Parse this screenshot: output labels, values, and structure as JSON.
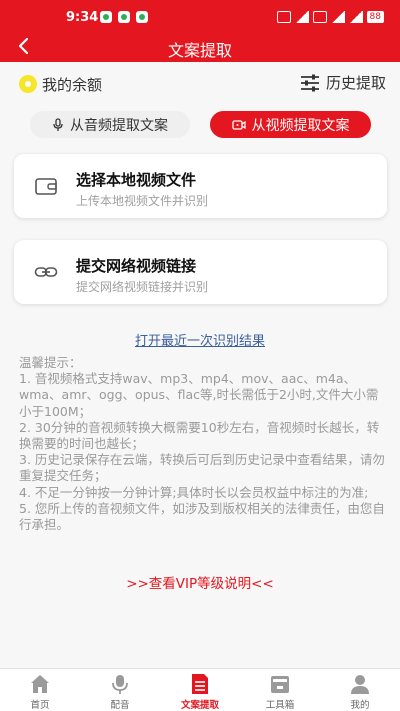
{
  "status_bar": {
    "time": "9:34",
    "battery": "88"
  },
  "header": {
    "title": "文案提取"
  },
  "balance": {
    "label": "我的余额"
  },
  "history": {
    "label": "历史提取"
  },
  "tabs": [
    {
      "label": "从音频提取文案",
      "active": false
    },
    {
      "label": "从视频提取文案",
      "active": true
    }
  ],
  "cards": [
    {
      "title": "选择本地视频文件",
      "subtitle": "上传本地视频文件并识别"
    },
    {
      "title": "提交网络视频链接",
      "subtitle": "提交网络视频链接并识别"
    }
  ],
  "recent_result_link": "打开最近一次识别结果",
  "tips": {
    "heading": "温馨提示：",
    "items": [
      "1. 音视频格式支持wav、mp3、mp4、mov、aac、m4a、wma、amr、ogg、opus、flac等,时长需低于2小时,文件大小需小于100M；",
      "2. 30分钟的音视频转换大概需要10秒左右，音视频时长越长，转换需要的时间也越长；",
      "3. 历史记录保存在云端，转换后可后到历史记录中查看结果，请勿重复提交任务；",
      "4. 不足一分钟按一分钟计算;具体时长以会员权益中标注的为准;",
      "5. 您所上传的音视频文件，如涉及到版权相关的法律责任，由您自行承担。"
    ]
  },
  "vip_link": ">>查看VIP等级说明<<",
  "bottom_nav": [
    {
      "label": "首页",
      "icon": "home-icon",
      "active": false
    },
    {
      "label": "配音",
      "icon": "microphone-icon",
      "active": false
    },
    {
      "label": "文案提取",
      "icon": "document-icon",
      "active": true
    },
    {
      "label": "工具箱",
      "icon": "toolbox-icon",
      "active": false
    },
    {
      "label": "我的",
      "icon": "user-icon",
      "active": false
    }
  ],
  "colors": {
    "accent": "#e4161f",
    "coin": "#f6e528",
    "link": "#3b5f9a",
    "tip_text": "#9a9a9a"
  }
}
